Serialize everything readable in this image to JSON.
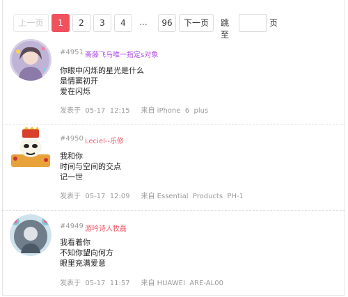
{
  "pagination": {
    "prev_label": "上一页",
    "pages": [
      "1",
      "2",
      "3",
      "4"
    ],
    "active_page": "1",
    "ellipsis": "...",
    "last_page": "96",
    "next_label": "下一页",
    "jump_label": "跳至",
    "jump_value": "",
    "page_unit": "页"
  },
  "comments": [
    {
      "floor": "#4951",
      "username": "斋藤飞鸟唯一指定s对象",
      "username_color": "#b14fe6",
      "lines": [
        "你眼中闪烁的星光是什么",
        "是情窦初开",
        "爱在闪烁"
      ],
      "meta": "发表于  05-17  12:15     来自 iPhone  6  plus"
    },
    {
      "floor": "#4950",
      "username": "Leciel--乐修",
      "username_color": "#f05a6a",
      "lines": [
        "我和你",
        "时间与空间的交点",
        "记一世"
      ],
      "meta": "发表于  05-17  12:09     来自 Essential  Products  PH-1"
    },
    {
      "floor": "#4949",
      "username": "游吟诗人牧磊",
      "username_color": "#f05a6a",
      "lines": [
        "我看着你",
        "不知你望向何方",
        "眼里充满爱意"
      ],
      "meta": "发表于  05-17  11:57     来自 HUAWEI  ARE-AL00"
    }
  ]
}
